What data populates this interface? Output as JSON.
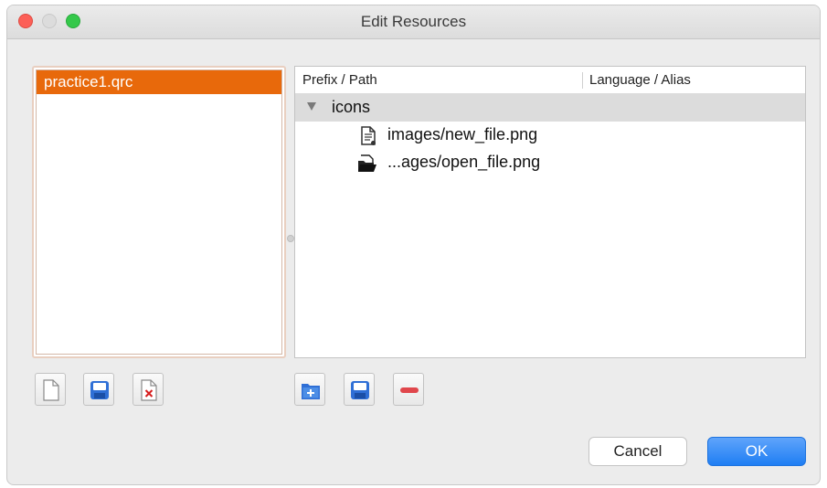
{
  "window": {
    "title": "Edit Resources"
  },
  "file_list": {
    "items": [
      {
        "label": "practice1.qrc",
        "selected": true
      }
    ]
  },
  "tree": {
    "columns": [
      "Prefix / Path",
      "Language / Alias"
    ],
    "prefix": "icons",
    "files": [
      {
        "path": "images/new_file.png",
        "icon": "document-icon"
      },
      {
        "path": "...ages/open_file.png",
        "icon": "open-folder-icon"
      }
    ]
  },
  "file_buttons": [
    "new-file-icon",
    "save-icon",
    "remove-file-icon"
  ],
  "resource_buttons": [
    "add-prefix-icon",
    "save-icon",
    "remove-icon"
  ],
  "buttons": {
    "cancel": "Cancel",
    "ok": "OK"
  },
  "colors": {
    "selection": "#e8690b",
    "ok_button": "#1f7ef3",
    "close": "#fc5f57",
    "zoom": "#34c84a"
  }
}
